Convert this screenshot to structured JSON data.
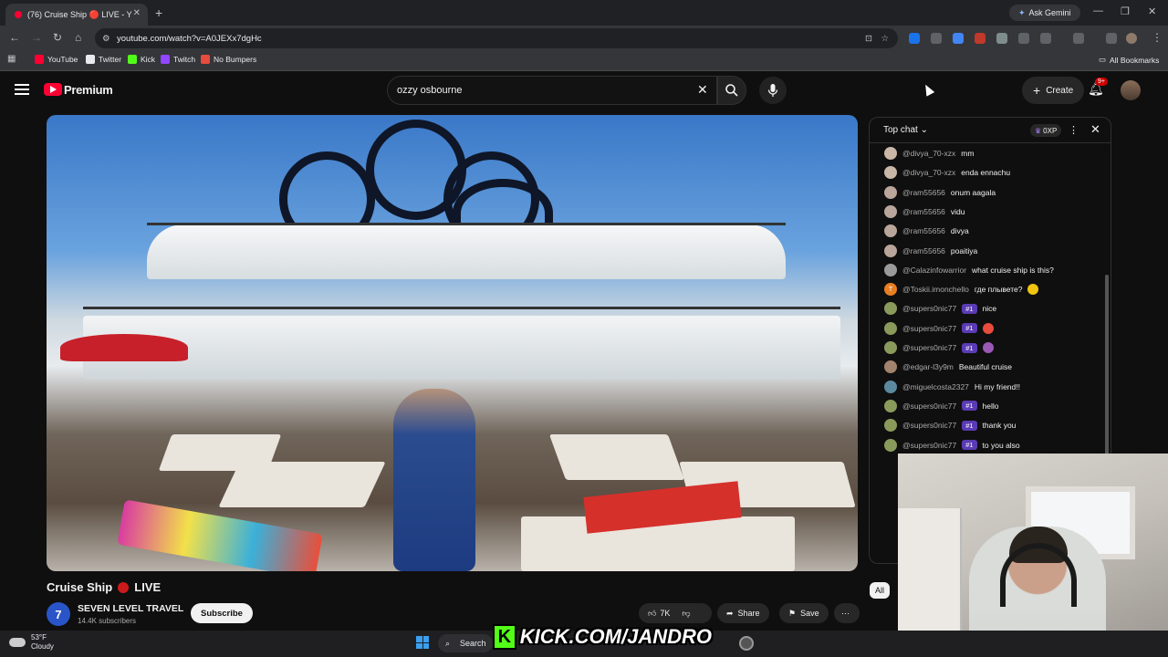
{
  "browser": {
    "tab_title": "(76) Cruise Ship 🔴 LIVE - Y",
    "ask_gemini": "Ask Gemini",
    "url": "youtube.com/watch?v=A0JEXx7dgHc",
    "bookmarks": [
      {
        "label": "YouTube",
        "color": "#ff0033"
      },
      {
        "label": "Twitter",
        "color": "#e8eaed"
      },
      {
        "label": "Kick",
        "color": "#53fc18"
      },
      {
        "label": "Twitch",
        "color": "#9146ff"
      },
      {
        "label": "No Bumpers",
        "color": "#e74c3c"
      }
    ],
    "all_bookmarks": "All Bookmarks"
  },
  "youtube": {
    "logo_label": "Premium",
    "search_value": "ozzy osbourne",
    "create_label": "Create",
    "notif_badge": "9+",
    "accent_color": "#ff0033"
  },
  "video": {
    "title": "Cruise Ship",
    "live_label": "LIVE",
    "channel_initial": "7",
    "channel_name": "SEVEN LEVEL TRAVEL",
    "subscribers": "14.4K subscribers",
    "subscribe_label": "Subscribe",
    "likes": "7K",
    "share_label": "Share",
    "save_label": "Save",
    "chip_all": "All"
  },
  "chat": {
    "header": "Top chat",
    "xp_label": "0XP",
    "messages": [
      {
        "author": "@divya_70-xzx",
        "text": "mm",
        "avatar_color": "#c9b7a8"
      },
      {
        "author": "@divya_70-xzx",
        "text": "enda ennachu",
        "avatar_color": "#c9b7a8"
      },
      {
        "author": "@ram55656",
        "text": "onum aagala",
        "avatar_color": "#b9a59a"
      },
      {
        "author": "@ram55656",
        "text": "vidu",
        "avatar_color": "#b9a59a"
      },
      {
        "author": "@ram55656",
        "text": "divya",
        "avatar_color": "#b9a59a"
      },
      {
        "author": "@ram55656",
        "text": "poaitiya",
        "avatar_color": "#b9a59a"
      },
      {
        "author": "@Calazinfowarrior",
        "text": "what cruise ship is this?",
        "avatar_color": "#9a9a9a"
      },
      {
        "author": "@Toskii.imonchello",
        "text": "где плывете?",
        "avatar_color": "#e67e22",
        "initial": "T",
        "emoji_color": "#f1c40f"
      },
      {
        "author": "@supers0nic77",
        "badge": "#1",
        "text": "nice",
        "avatar_color": "#8a9a5b"
      },
      {
        "author": "@supers0nic77",
        "badge": "#1",
        "text": "",
        "avatar_color": "#8a9a5b",
        "emoji_color": "#e74c3c"
      },
      {
        "author": "@supers0nic77",
        "badge": "#1",
        "text": "",
        "avatar_color": "#8a9a5b",
        "emoji_color": "#9b59b6"
      },
      {
        "author": "@edgar-l3y9m",
        "text": "Beautiful cruise",
        "avatar_color": "#a0826d"
      },
      {
        "author": "@miguelcosta2327",
        "text": "Hi my friend!!",
        "avatar_color": "#5b8aa0"
      },
      {
        "author": "@supers0nic77",
        "badge": "#1",
        "text": "hello",
        "avatar_color": "#8a9a5b"
      },
      {
        "author": "@supers0nic77",
        "badge": "#1",
        "text": "thank you",
        "avatar_color": "#8a9a5b"
      },
      {
        "author": "@supers0nic77",
        "badge": "#1",
        "text": "to you also",
        "avatar_color": "#8a9a5b"
      }
    ]
  },
  "taskbar": {
    "temperature": "53°F",
    "condition": "Cloudy",
    "search_label": "Search"
  },
  "overlay": {
    "kick_url": "KICK.COM/JANDRO",
    "kick_logo": "K",
    "kick_color": "#53fc18"
  }
}
